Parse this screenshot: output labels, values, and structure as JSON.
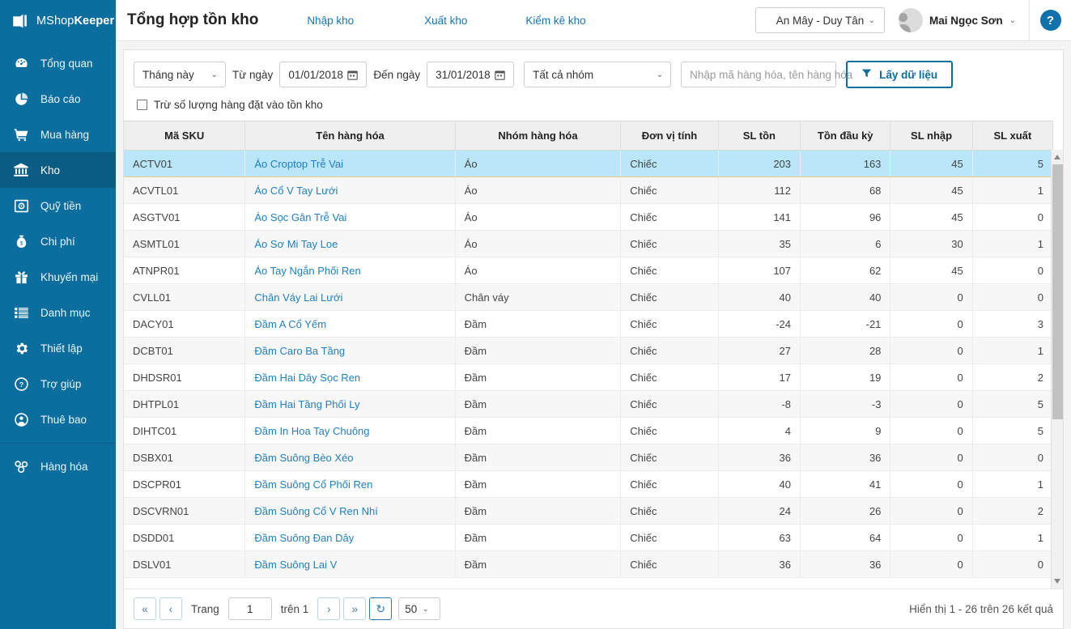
{
  "brand": {
    "name_light": "MShop",
    "name_bold": "Keeper",
    "logo_icon": "shopping-bag-icon",
    "bg_color": "#0b6e9e"
  },
  "sidebar": {
    "items": [
      {
        "label": "Tổng quan",
        "icon": "dashboard-icon",
        "active": false
      },
      {
        "label": "Báo cáo",
        "icon": "pie-chart-icon",
        "active": false
      },
      {
        "label": "Mua hàng",
        "icon": "shopping-cart-icon",
        "active": false
      },
      {
        "label": "Kho",
        "icon": "bank-icon",
        "active": true
      },
      {
        "label": "Quỹ tiền",
        "icon": "safe-box-icon",
        "active": false
      },
      {
        "label": "Chi phí",
        "icon": "money-bag-icon",
        "active": false
      },
      {
        "label": "Khuyến mại",
        "icon": "gift-icon",
        "active": false
      },
      {
        "label": "Danh mục",
        "icon": "list-icon",
        "active": false
      },
      {
        "label": "Thiết lập",
        "icon": "gear-icon",
        "active": false
      },
      {
        "label": "Trợ giúp",
        "icon": "question-circle-icon",
        "active": false
      },
      {
        "label": "Thuê bao",
        "icon": "user-circle-icon",
        "active": false
      }
    ],
    "footer_items": [
      {
        "label": "Hàng hóa",
        "icon": "boxes-icon",
        "active": false
      }
    ]
  },
  "header": {
    "title": "Tổng hợp tồn kho",
    "tabs": [
      {
        "label": "Nhập kho"
      },
      {
        "label": "Xuất kho"
      },
      {
        "label": "Kiểm kê kho"
      }
    ],
    "branch": "An Mây - Duy Tân",
    "user": "Mai Ngọc Sơn",
    "help_label": "?",
    "caret": "⌄"
  },
  "filters": {
    "period": "Tháng này",
    "from_label": "Từ ngày",
    "from_date": "01/01/2018",
    "to_label": "Đến ngày",
    "to_date": "31/01/2018",
    "group": "Tất cả nhóm",
    "search_placeholder": "Nhập mã hàng hóa, tên hàng hóa",
    "search_value": "",
    "submit_label": "Lấy dữ liệu",
    "checkbox_label": "Trừ số lượng hàng đặt vào tồn kho",
    "checkbox_checked": false
  },
  "table": {
    "columns": [
      "Mã SKU",
      "Tên hàng hóa",
      "Nhóm hàng hóa",
      "Đơn vị tính",
      "SL tồn",
      "Tồn đầu kỳ",
      "SL nhập",
      "SL xuất"
    ],
    "rows": [
      {
        "sku": "ACTV01",
        "name": "Áo Croptop Trễ Vai",
        "group": "Áo",
        "unit": "Chiếc",
        "ton": "203",
        "dauky": "163",
        "nhap": "45",
        "xuat": "5",
        "selected": true
      },
      {
        "sku": "ACVTL01",
        "name": "Áo Cổ V Tay Lưới",
        "group": "Áo",
        "unit": "Chiếc",
        "ton": "112",
        "dauky": "68",
        "nhap": "45",
        "xuat": "1",
        "selected": false
      },
      {
        "sku": "ASGTV01",
        "name": "Áo Sọc Gân Trễ Vai",
        "group": "Áo",
        "unit": "Chiếc",
        "ton": "141",
        "dauky": "96",
        "nhap": "45",
        "xuat": "0",
        "selected": false
      },
      {
        "sku": "ASMTL01",
        "name": "Áo Sơ Mi Tay Loe",
        "group": "Áo",
        "unit": "Chiếc",
        "ton": "35",
        "dauky": "6",
        "nhap": "30",
        "xuat": "1",
        "selected": false
      },
      {
        "sku": "ATNPR01",
        "name": "Áo Tay Ngắn Phối Ren",
        "group": "Áo",
        "unit": "Chiếc",
        "ton": "107",
        "dauky": "62",
        "nhap": "45",
        "xuat": "0",
        "selected": false
      },
      {
        "sku": "CVLL01",
        "name": "Chân Váy Lai Lưới",
        "group": "Chân váy",
        "unit": "Chiếc",
        "ton": "40",
        "dauky": "40",
        "nhap": "0",
        "xuat": "0",
        "selected": false
      },
      {
        "sku": "DACY01",
        "name": "Đầm A Cổ Yếm",
        "group": "Đầm",
        "unit": "Chiếc",
        "ton": "-24",
        "dauky": "-21",
        "nhap": "0",
        "xuat": "3",
        "selected": false
      },
      {
        "sku": "DCBT01",
        "name": "Đầm Caro Ba Tầng",
        "group": "Đầm",
        "unit": "Chiếc",
        "ton": "27",
        "dauky": "28",
        "nhap": "0",
        "xuat": "1",
        "selected": false
      },
      {
        "sku": "DHDSR01",
        "name": "Đầm Hai Dây Sọc Ren",
        "group": "Đầm",
        "unit": "Chiếc",
        "ton": "17",
        "dauky": "19",
        "nhap": "0",
        "xuat": "2",
        "selected": false
      },
      {
        "sku": "DHTPL01",
        "name": "Đầm Hai Tầng Phối Ly",
        "group": "Đầm",
        "unit": "Chiếc",
        "ton": "-8",
        "dauky": "-3",
        "nhap": "0",
        "xuat": "5",
        "selected": false
      },
      {
        "sku": "DIHTC01",
        "name": "Đầm In Hoa Tay Chuông",
        "group": "Đầm",
        "unit": "Chiếc",
        "ton": "4",
        "dauky": "9",
        "nhap": "0",
        "xuat": "5",
        "selected": false
      },
      {
        "sku": "DSBX01",
        "name": "Đầm Suông Bèo Xéo",
        "group": "Đầm",
        "unit": "Chiếc",
        "ton": "36",
        "dauky": "36",
        "nhap": "0",
        "xuat": "0",
        "selected": false
      },
      {
        "sku": "DSCPR01",
        "name": "Đầm Suông Cổ Phối Ren",
        "group": "Đầm",
        "unit": "Chiếc",
        "ton": "40",
        "dauky": "41",
        "nhap": "0",
        "xuat": "1",
        "selected": false
      },
      {
        "sku": "DSCVRN01",
        "name": "Đầm Suông Cổ V Ren Nhí",
        "group": "Đầm",
        "unit": "Chiếc",
        "ton": "24",
        "dauky": "26",
        "nhap": "0",
        "xuat": "2",
        "selected": false
      },
      {
        "sku": "DSDD01",
        "name": "Đầm Suông Đan Dây",
        "group": "Đầm",
        "unit": "Chiếc",
        "ton": "63",
        "dauky": "64",
        "nhap": "0",
        "xuat": "1",
        "selected": false
      },
      {
        "sku": "DSLV01",
        "name": "Đầm Suông Lai V",
        "group": "Đầm",
        "unit": "Chiếc",
        "ton": "36",
        "dauky": "36",
        "nhap": "0",
        "xuat": "0",
        "selected": false
      }
    ]
  },
  "pager": {
    "first": "«",
    "prev": "‹",
    "page_label": "Trang",
    "page_value": "1",
    "of_label": "trên 1",
    "next": "›",
    "last": "»",
    "refresh": "↻",
    "page_size": "50",
    "caret": "⌄",
    "summary": "Hiển thị 1 - 26 trên 26 kết quả"
  }
}
